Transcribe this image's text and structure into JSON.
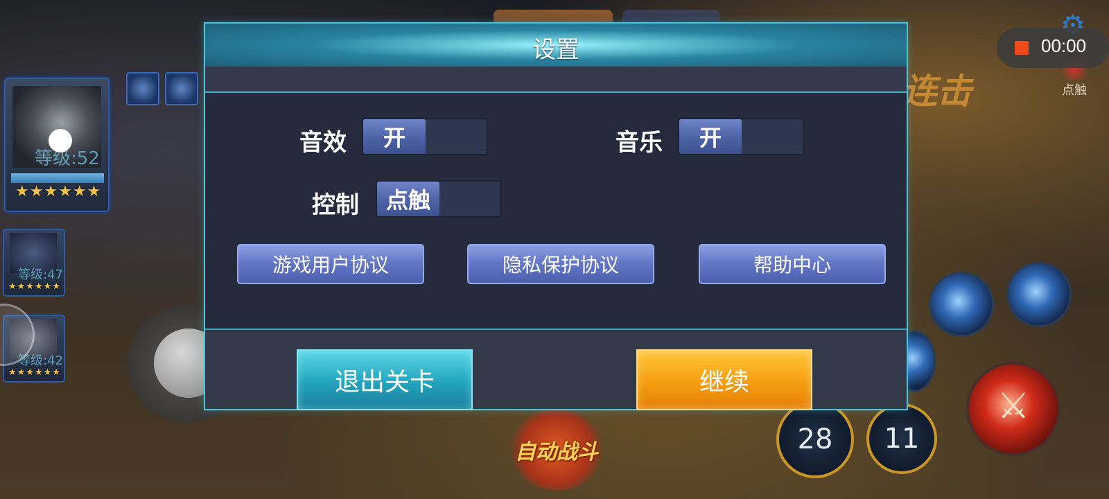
{
  "dialog": {
    "title": "设置",
    "settings": {
      "sound": {
        "label": "音效",
        "value": "开"
      },
      "music": {
        "label": "音乐",
        "value": "开"
      },
      "control": {
        "label": "控制",
        "value": "点触"
      }
    },
    "links": {
      "user_agreement": "游戏用户协议",
      "privacy_policy": "隐私保护协议",
      "help_center": "帮助中心"
    },
    "exit_label": "退出关卡",
    "continue_label": "继续"
  },
  "hud": {
    "hero_main": {
      "level": "等级:52",
      "stars": "★★★★★★"
    },
    "hero_2": {
      "level": "等级:47",
      "stars": "★★★★★★"
    },
    "hero_3": {
      "level": "等级:42",
      "stars": "★★★★★★"
    },
    "combo_text": "连击",
    "touch_label": "点触",
    "auto_battle": "自动战斗",
    "skill_count_1": "28",
    "skill_count_2": "11",
    "attack_icon": "⚔"
  },
  "recorder": {
    "time": "00:00"
  },
  "colors": {
    "dialog_bg": "#252b3d",
    "dialog_border": "#4fc3d8",
    "link_button": "#6478c6",
    "exit_button": "#25a9c2",
    "continue_button": "#f59e10",
    "record_indicator": "#f04a1a"
  }
}
